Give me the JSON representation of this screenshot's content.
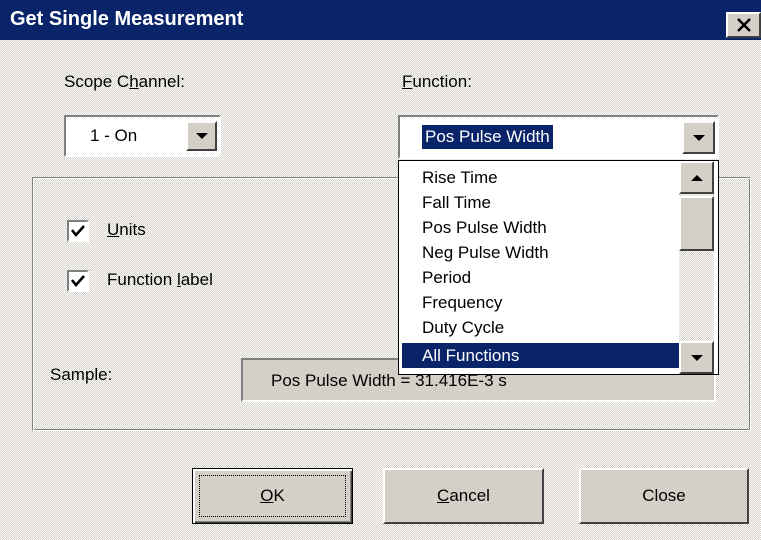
{
  "window": {
    "title": "Get Single Measurement"
  },
  "scope_channel": {
    "label_pre": "Scope C",
    "label_accel": "h",
    "label_post": "annel:",
    "value": "1 - On"
  },
  "function": {
    "label_accel": "F",
    "label_post": "unction:",
    "value": "Pos Pulse Width",
    "options": [
      "Rise Time",
      "Fall Time",
      "Pos Pulse Width",
      "Neg Pulse Width",
      "Period",
      "Frequency",
      "Duty Cycle",
      "All Functions"
    ],
    "highlighted": "All Functions"
  },
  "options": {
    "units": {
      "label_accel": "U",
      "label_post": "nits",
      "checked": true
    },
    "function_label": {
      "label_pre": "Function ",
      "label_accel": "l",
      "label_post": "abel",
      "checked": true
    }
  },
  "sample": {
    "label": "Sample:",
    "value": "Pos Pulse Width = 31.416E-3 s"
  },
  "buttons": {
    "ok": {
      "accel": "O",
      "post": "K"
    },
    "cancel": {
      "accel": "C",
      "post": "ancel"
    },
    "close": "Close"
  },
  "colors": {
    "titlebar": "#0a246a",
    "selection": "#0a246a",
    "face": "#d4d0c8"
  }
}
